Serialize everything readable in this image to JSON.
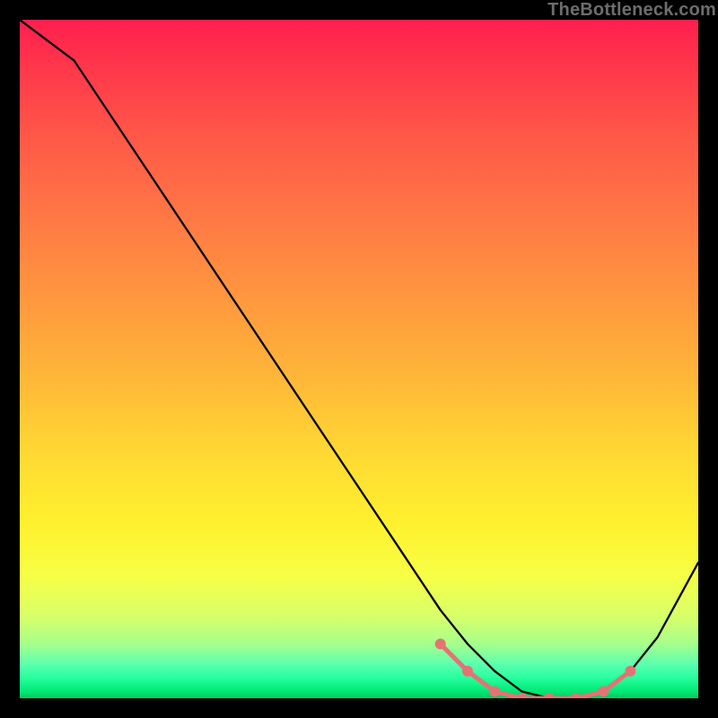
{
  "attribution": "TheBottleneck.com",
  "chart_data": {
    "type": "line",
    "title": "",
    "xlabel": "",
    "ylabel": "",
    "xlim": [
      0,
      100
    ],
    "ylim": [
      0,
      100
    ],
    "series": [
      {
        "name": "bottleneck-curve",
        "x": [
          0,
          8,
          14,
          20,
          26,
          32,
          38,
          44,
          50,
          56,
          62,
          66,
          70,
          74,
          78,
          82,
          86,
          90,
          94,
          100
        ],
        "y": [
          100,
          94,
          85,
          76,
          67,
          58,
          49,
          40,
          31,
          22,
          13,
          8,
          4,
          1,
          0,
          0,
          1,
          4,
          9,
          20
        ]
      }
    ],
    "highlight": {
      "name": "optimal-range",
      "x": [
        62,
        66,
        70,
        74,
        78,
        82,
        86,
        90
      ],
      "y": [
        8,
        4,
        1,
        0,
        0,
        0,
        1,
        4
      ]
    },
    "axes_visible": false,
    "grid": false
  }
}
